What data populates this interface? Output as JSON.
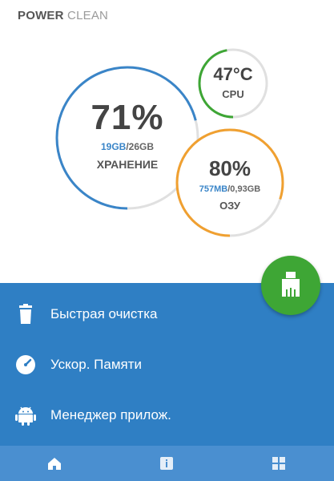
{
  "header": {
    "title_bold": "POWER",
    "title_light": "CLEAN"
  },
  "storage": {
    "percent": "71%",
    "used": "19GB",
    "separator": "/",
    "total": "26GB",
    "label": "ХРАНЕНИЕ",
    "fill_fraction": 0.71,
    "color": "#3a85c8"
  },
  "cpu": {
    "temp": "47°C",
    "label": "CPU",
    "fill_fraction": 0.47,
    "color": "#3ea635"
  },
  "ram": {
    "percent": "80%",
    "used": "757MB",
    "separator": "/",
    "total": "0,93GB",
    "label": "ОЗУ",
    "fill_fraction": 0.8,
    "color": "#f0a030"
  },
  "fab": {
    "icon": "broom-icon",
    "color": "#3ea635"
  },
  "menu": [
    {
      "label": "Быстрая очистка",
      "icon": "trash-icon"
    },
    {
      "label": "Ускор. Памяти",
      "icon": "speedometer-icon"
    },
    {
      "label": "Менеджер прилож.",
      "icon": "android-icon"
    }
  ],
  "tabs": [
    {
      "icon": "home-icon",
      "active": true
    },
    {
      "icon": "info-icon",
      "active": false
    },
    {
      "icon": "grid-icon",
      "active": false
    }
  ],
  "colors": {
    "panel": "#2f7fc4",
    "bottom_bar": "#4a8fd0",
    "track": "#e0e0e0"
  }
}
